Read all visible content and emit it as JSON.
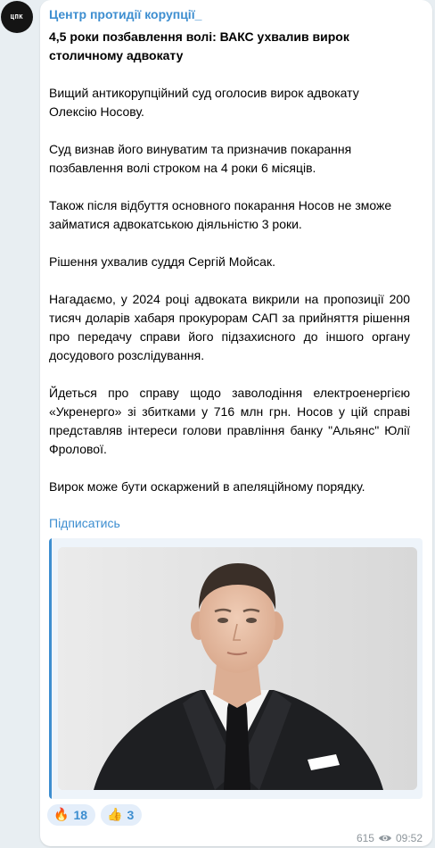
{
  "channel": {
    "avatar_text": "ЦПК",
    "name": "Центр протидії корупції_"
  },
  "post": {
    "title": "4,5 роки позбавлення волі: ВАКС ухвалив вирок столичному адвокату",
    "paragraphs": [
      "Вищий антикорупційний суд оголосив вирок адвокату Олексію Носову.",
      "Суд визнав його винуватим та призначив покарання позбавлення волі строком на 4 роки 6 місяців.",
      "Також після відбуття основного покарання Носов не зможе займатися адвокатською діяльністю 3 роки.",
      "Рішення ухвалив суддя Сергій Мойсак.",
      "Нагадаємо, у 2024 році адвоката викрили на пропозиції 200 тисяч доларів хабаря прокурорам САП за прийняття рішення про передачу справи його підзахисного до іншого органу досудового розслідування.",
      "Йдеться про справу щодо заволодіння електроенергією «Укренерго» зі збитками у 716 млн грн. Носов у цій справі представляв інтереси голови правління банку \"Альянс\" Юлії Фролової.",
      "Вирок може бути оскаржений в апеляційному порядку."
    ],
    "subscribe_label": "Підписатись"
  },
  "reactions": [
    {
      "emoji": "🔥",
      "icon": "fire-icon",
      "count": "18"
    },
    {
      "emoji": "👍",
      "icon": "thumbs-up-icon",
      "count": "3"
    }
  ],
  "meta": {
    "views": "615",
    "time": "09:52"
  },
  "colors": {
    "background": "#e8eef2",
    "bubble": "#ffffff",
    "link": "#3d8ed0",
    "reaction_bg": "#e4eefa",
    "meta_text": "#8e969c"
  }
}
